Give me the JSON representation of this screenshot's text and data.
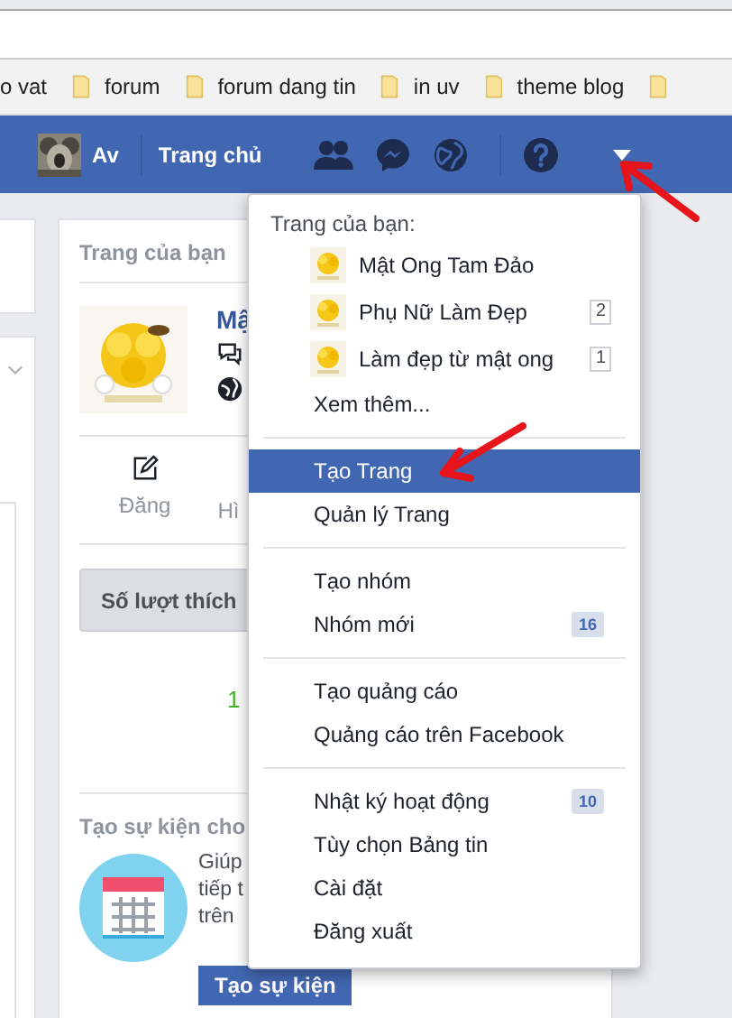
{
  "bookmarks": [
    "o vat",
    "forum",
    "forum dang tin",
    "in uv",
    "theme blog"
  ],
  "topbar": {
    "user": "Av",
    "home": "Trang chủ"
  },
  "card": {
    "title": "Trang của bạn",
    "page_name": "Mậ",
    "actions": [
      "Đăng",
      "Hì"
    ],
    "likes_tab": "Số lượt thích",
    "count": "1",
    "event_title": "Tạo sự kiện cho",
    "event_text": [
      "Giúp",
      "tiếp t",
      "trên"
    ],
    "event_button": "Tạo sự kiện"
  },
  "menu": {
    "header": "Trang của bạn:",
    "pages": [
      {
        "name": "Mật Ong Tam Đảo",
        "selected": false
      },
      {
        "name": "Phụ Nữ Làm Đẹp",
        "badge": "2",
        "selected": false
      },
      {
        "name": "Làm đẹp từ mật ong",
        "badge": "1",
        "selected": false
      }
    ],
    "more": "Xem thêm...",
    "sections": [
      [
        {
          "label": "Tạo Trang",
          "selected": true
        },
        {
          "label": "Quản lý Trang",
          "selected": false
        }
      ],
      [
        {
          "label": "Tạo nhóm",
          "selected": false
        },
        {
          "label": "Nhóm mới",
          "badge": "16",
          "selected": false
        }
      ],
      [
        {
          "label": "Tạo quảng cáo",
          "selected": false
        },
        {
          "label": "Quảng cáo trên Facebook",
          "selected": false
        }
      ],
      [
        {
          "label": "Nhật ký hoạt động",
          "badge": "10",
          "selected": false
        },
        {
          "label": "Tùy chọn Bảng tin",
          "selected": false
        },
        {
          "label": "Cài đặt",
          "selected": false
        },
        {
          "label": "Đăng xuất",
          "selected": false
        }
      ]
    ]
  }
}
